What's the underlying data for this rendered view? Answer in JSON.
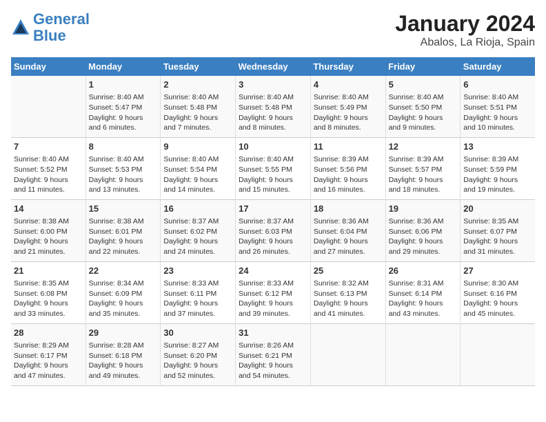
{
  "header": {
    "logo_line1": "General",
    "logo_line2": "Blue",
    "title": "January 2024",
    "subtitle": "Abalos, La Rioja, Spain"
  },
  "days_of_week": [
    "Sunday",
    "Monday",
    "Tuesday",
    "Wednesday",
    "Thursday",
    "Friday",
    "Saturday"
  ],
  "weeks": [
    [
      {
        "day": "",
        "content": ""
      },
      {
        "day": "1",
        "content": "Sunrise: 8:40 AM\nSunset: 5:47 PM\nDaylight: 9 hours\nand 6 minutes."
      },
      {
        "day": "2",
        "content": "Sunrise: 8:40 AM\nSunset: 5:48 PM\nDaylight: 9 hours\nand 7 minutes."
      },
      {
        "day": "3",
        "content": "Sunrise: 8:40 AM\nSunset: 5:48 PM\nDaylight: 9 hours\nand 8 minutes."
      },
      {
        "day": "4",
        "content": "Sunrise: 8:40 AM\nSunset: 5:49 PM\nDaylight: 9 hours\nand 8 minutes."
      },
      {
        "day": "5",
        "content": "Sunrise: 8:40 AM\nSunset: 5:50 PM\nDaylight: 9 hours\nand 9 minutes."
      },
      {
        "day": "6",
        "content": "Sunrise: 8:40 AM\nSunset: 5:51 PM\nDaylight: 9 hours\nand 10 minutes."
      }
    ],
    [
      {
        "day": "7",
        "content": "Sunrise: 8:40 AM\nSunset: 5:52 PM\nDaylight: 9 hours\nand 11 minutes."
      },
      {
        "day": "8",
        "content": "Sunrise: 8:40 AM\nSunset: 5:53 PM\nDaylight: 9 hours\nand 13 minutes."
      },
      {
        "day": "9",
        "content": "Sunrise: 8:40 AM\nSunset: 5:54 PM\nDaylight: 9 hours\nand 14 minutes."
      },
      {
        "day": "10",
        "content": "Sunrise: 8:40 AM\nSunset: 5:55 PM\nDaylight: 9 hours\nand 15 minutes."
      },
      {
        "day": "11",
        "content": "Sunrise: 8:39 AM\nSunset: 5:56 PM\nDaylight: 9 hours\nand 16 minutes."
      },
      {
        "day": "12",
        "content": "Sunrise: 8:39 AM\nSunset: 5:57 PM\nDaylight: 9 hours\nand 18 minutes."
      },
      {
        "day": "13",
        "content": "Sunrise: 8:39 AM\nSunset: 5:59 PM\nDaylight: 9 hours\nand 19 minutes."
      }
    ],
    [
      {
        "day": "14",
        "content": "Sunrise: 8:38 AM\nSunset: 6:00 PM\nDaylight: 9 hours\nand 21 minutes."
      },
      {
        "day": "15",
        "content": "Sunrise: 8:38 AM\nSunset: 6:01 PM\nDaylight: 9 hours\nand 22 minutes."
      },
      {
        "day": "16",
        "content": "Sunrise: 8:37 AM\nSunset: 6:02 PM\nDaylight: 9 hours\nand 24 minutes."
      },
      {
        "day": "17",
        "content": "Sunrise: 8:37 AM\nSunset: 6:03 PM\nDaylight: 9 hours\nand 26 minutes."
      },
      {
        "day": "18",
        "content": "Sunrise: 8:36 AM\nSunset: 6:04 PM\nDaylight: 9 hours\nand 27 minutes."
      },
      {
        "day": "19",
        "content": "Sunrise: 8:36 AM\nSunset: 6:06 PM\nDaylight: 9 hours\nand 29 minutes."
      },
      {
        "day": "20",
        "content": "Sunrise: 8:35 AM\nSunset: 6:07 PM\nDaylight: 9 hours\nand 31 minutes."
      }
    ],
    [
      {
        "day": "21",
        "content": "Sunrise: 8:35 AM\nSunset: 6:08 PM\nDaylight: 9 hours\nand 33 minutes."
      },
      {
        "day": "22",
        "content": "Sunrise: 8:34 AM\nSunset: 6:09 PM\nDaylight: 9 hours\nand 35 minutes."
      },
      {
        "day": "23",
        "content": "Sunrise: 8:33 AM\nSunset: 6:11 PM\nDaylight: 9 hours\nand 37 minutes."
      },
      {
        "day": "24",
        "content": "Sunrise: 8:33 AM\nSunset: 6:12 PM\nDaylight: 9 hours\nand 39 minutes."
      },
      {
        "day": "25",
        "content": "Sunrise: 8:32 AM\nSunset: 6:13 PM\nDaylight: 9 hours\nand 41 minutes."
      },
      {
        "day": "26",
        "content": "Sunrise: 8:31 AM\nSunset: 6:14 PM\nDaylight: 9 hours\nand 43 minutes."
      },
      {
        "day": "27",
        "content": "Sunrise: 8:30 AM\nSunset: 6:16 PM\nDaylight: 9 hours\nand 45 minutes."
      }
    ],
    [
      {
        "day": "28",
        "content": "Sunrise: 8:29 AM\nSunset: 6:17 PM\nDaylight: 9 hours\nand 47 minutes."
      },
      {
        "day": "29",
        "content": "Sunrise: 8:28 AM\nSunset: 6:18 PM\nDaylight: 9 hours\nand 49 minutes."
      },
      {
        "day": "30",
        "content": "Sunrise: 8:27 AM\nSunset: 6:20 PM\nDaylight: 9 hours\nand 52 minutes."
      },
      {
        "day": "31",
        "content": "Sunrise: 8:26 AM\nSunset: 6:21 PM\nDaylight: 9 hours\nand 54 minutes."
      },
      {
        "day": "",
        "content": ""
      },
      {
        "day": "",
        "content": ""
      },
      {
        "day": "",
        "content": ""
      }
    ]
  ]
}
